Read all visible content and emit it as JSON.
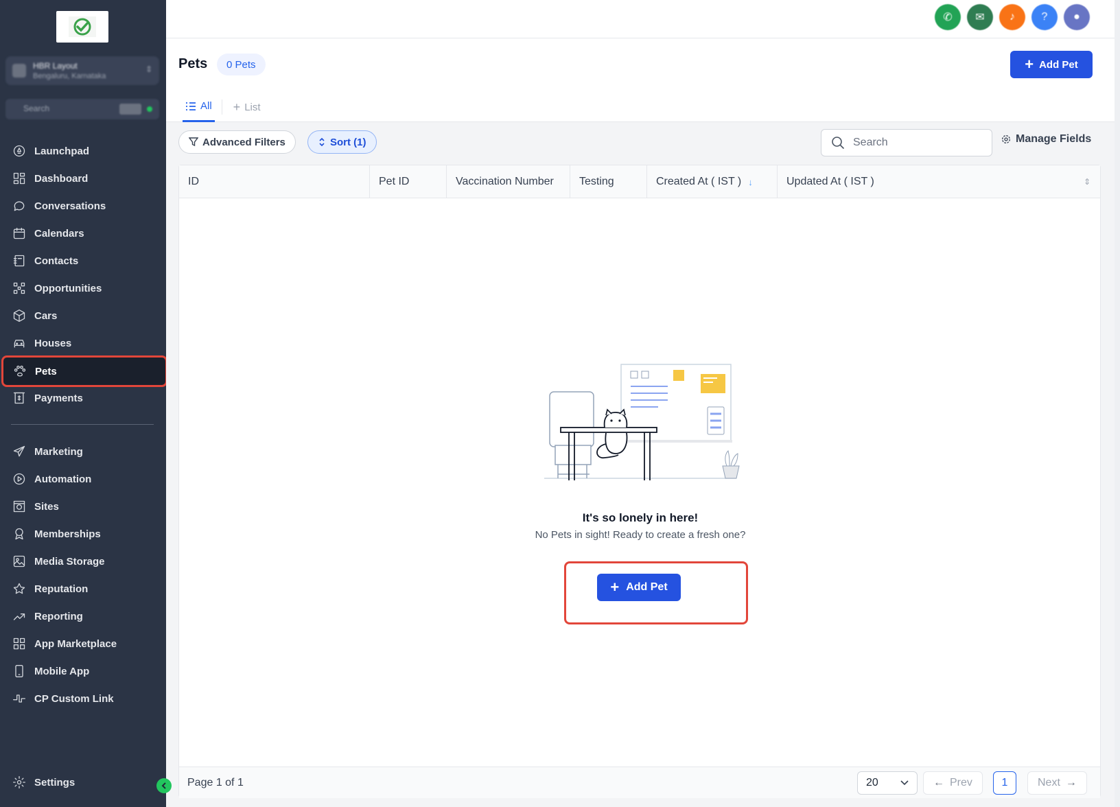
{
  "sidebar": {
    "account": {
      "name": "HBR Layout",
      "location": "Bengaluru, Karnataka"
    },
    "quick_search_label": "Search",
    "quick_search_shortcut": "⌘K",
    "items": [
      {
        "label": "Launchpad",
        "icon": "rocket-icon"
      },
      {
        "label": "Dashboard",
        "icon": "grid-icon"
      },
      {
        "label": "Conversations",
        "icon": "chat-icon"
      },
      {
        "label": "Calendars",
        "icon": "calendar-icon"
      },
      {
        "label": "Contacts",
        "icon": "address-book-icon"
      },
      {
        "label": "Opportunities",
        "icon": "network-icon"
      },
      {
        "label": "Cars",
        "icon": "cube-icon"
      },
      {
        "label": "Houses",
        "icon": "car-icon"
      },
      {
        "label": "Pets",
        "icon": "paw-icon",
        "active": true
      },
      {
        "label": "Payments",
        "icon": "invoice-icon"
      },
      {
        "label": "Marketing",
        "icon": "send-icon"
      },
      {
        "label": "Automation",
        "icon": "play-circle-icon"
      },
      {
        "label": "Sites",
        "icon": "globe-icon"
      },
      {
        "label": "Memberships",
        "icon": "badge-icon"
      },
      {
        "label": "Media Storage",
        "icon": "image-icon"
      },
      {
        "label": "Reputation",
        "icon": "star-icon"
      },
      {
        "label": "Reporting",
        "icon": "trend-icon"
      },
      {
        "label": "App Marketplace",
        "icon": "apps-icon"
      },
      {
        "label": "Mobile App",
        "icon": "mobile-icon"
      },
      {
        "label": "CP Custom Link",
        "icon": "link-icon"
      }
    ],
    "settings_label": "Settings"
  },
  "topbar": {
    "icons": [
      {
        "name": "phone-icon",
        "color": "#22a355"
      },
      {
        "name": "megaphone-icon",
        "color": "#2f7d52"
      },
      {
        "name": "bell-icon",
        "color": "#f97316"
      },
      {
        "name": "help-icon",
        "color": "#3b82f6"
      },
      {
        "name": "avatar",
        "color": "#6875c4"
      }
    ]
  },
  "page": {
    "title": "Pets",
    "count_badge": "0 Pets",
    "add_button": "Add Pet",
    "tabs": [
      {
        "label": "All",
        "active": true
      },
      {
        "label": "List",
        "active": false
      }
    ]
  },
  "filters": {
    "advanced": "Advanced Filters",
    "sort": "Sort (1)",
    "search_placeholder": "Search",
    "manage_fields": "Manage Fields"
  },
  "table": {
    "columns": [
      "ID",
      "Pet ID",
      "Vaccination Number",
      "Testing",
      "Created At ( IST )",
      "Updated At ( IST )"
    ],
    "rows": []
  },
  "empty_state": {
    "title": "It's so lonely in here!",
    "subtitle": "No Pets in sight! Ready to create a fresh one?",
    "button": "Add Pet"
  },
  "pagination": {
    "page_info": "Page 1 of 1",
    "per_page": "20",
    "prev": "Prev",
    "current": "1",
    "next": "Next"
  },
  "colors": {
    "sidebar_bg": "#2b3445",
    "primary": "#2552e0",
    "highlight": "#e2463a"
  }
}
